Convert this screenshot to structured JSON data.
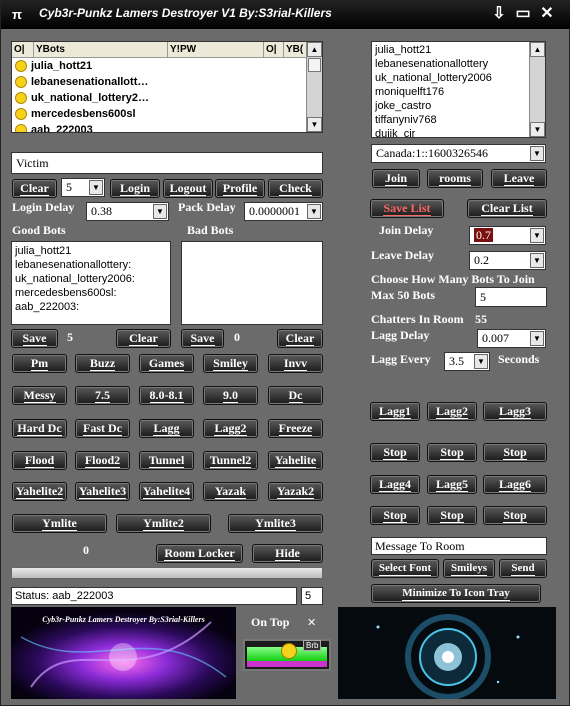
{
  "window": {
    "title": "Cyb3r-Punkz Lamers Destroyer V1  By:S3rial-Killers",
    "icon": "π"
  },
  "titlebar_buttons": [
    "⇩",
    "▭",
    "✕"
  ],
  "ybots": {
    "headers": [
      "O|",
      "YBots",
      "Y!PW",
      "O|",
      "YB("
    ],
    "rows": [
      "julia_hott21",
      "lebanesenationallott…",
      "uk_national_lottery2…",
      "mercedesbens600sl",
      "aab_222003"
    ]
  },
  "victim": {
    "label": "Victim"
  },
  "controls": {
    "clear": "Clear",
    "count": "5",
    "login": "Login",
    "logout": "Logout",
    "profile": "Profile",
    "check": "Check"
  },
  "login_delay": {
    "label": "Login Delay",
    "value": "0.38"
  },
  "pack_delay": {
    "label": "Pack Delay",
    "value": "0.0000001"
  },
  "good_bots": {
    "label": "Good Bots",
    "rows": [
      "julia_hott21",
      "lebanesenationallottery:",
      "uk_national_lottery2006:",
      "mercedesbens600sl:",
      "aab_222003:"
    ],
    "save": "Save",
    "count": "5",
    "clear": "Clear"
  },
  "bad_bots": {
    "label": "Bad Bots",
    "save": "Save",
    "count": "0",
    "clear": "Clear"
  },
  "attack_buttons": [
    [
      "Pm",
      "Buzz",
      "Games",
      "Smiley",
      "Invv"
    ],
    [
      "Messy",
      "7.5",
      "8.0-8.1",
      "9.0",
      "Dc"
    ],
    [
      "Hard Dc",
      "Fast Dc",
      "Lagg",
      "Lagg2",
      "Freeze"
    ],
    [
      "Flood",
      "Flood2",
      "Tunnel",
      "Tunnel2",
      "Yahelite"
    ],
    [
      "Yahelite2",
      "Yahelite3",
      "Yahelite4",
      "Yazak",
      "Yazak2"
    ],
    [
      "Ymlite",
      "Ymlite2",
      "Ymlite3"
    ]
  ],
  "counter_zero": "0",
  "room_locker": "Room Locker",
  "hide": "Hide",
  "status": {
    "text": "Status: aab_222003",
    "count": "5"
  },
  "banner_text": "Cyb3r-Punkz Lamers Destroyer  By:S3rial-Killers",
  "on_top": {
    "label": "On Top",
    "brb": "Brb",
    "close": "✕"
  },
  "rooms_list": [
    "julia_hott21",
    "lebanesenationallottery",
    "uk_national_lottery2006",
    "moniquelft176",
    "joke_castro",
    "tiffanyniv768",
    "dujik_cir"
  ],
  "room_select": "Canada:1::1600326546",
  "room_buttons": {
    "join": "Join",
    "rooms": "rooms",
    "leave": "Leave"
  },
  "list_buttons": {
    "save": "Save List",
    "clear": "Clear List"
  },
  "join_delay": {
    "label": "Join Delay",
    "value": "0.7"
  },
  "leave_delay": {
    "label": "Leave Delay",
    "value": "0.2"
  },
  "choose_bots": {
    "label": "Choose How Many Bots To Join",
    "max_label": "Max 50 Bots",
    "value": "5"
  },
  "chatters": {
    "label": "Chatters In Room",
    "value": "55"
  },
  "lagg_delay": {
    "label": "Lagg Delay",
    "value": "0.007"
  },
  "lagg_every": {
    "label": "Lagg Every",
    "value": "3.5",
    "unit": "Seconds"
  },
  "lagg_rows": [
    [
      "Lagg1",
      "Lagg2",
      "Lagg3"
    ],
    [
      "Stop",
      "Stop",
      "Stop"
    ],
    [
      "Lagg4",
      "Lagg5",
      "Lagg6"
    ],
    [
      "Stop",
      "Stop",
      "Stop"
    ]
  ],
  "message": {
    "placeholder": "Message To Room",
    "font": "Select Font",
    "smileys": "Smileys",
    "send": "Send",
    "minimize": "Minimize To Icon Tray"
  },
  "colors": {
    "join_delay_highlight": "#7a1010"
  }
}
